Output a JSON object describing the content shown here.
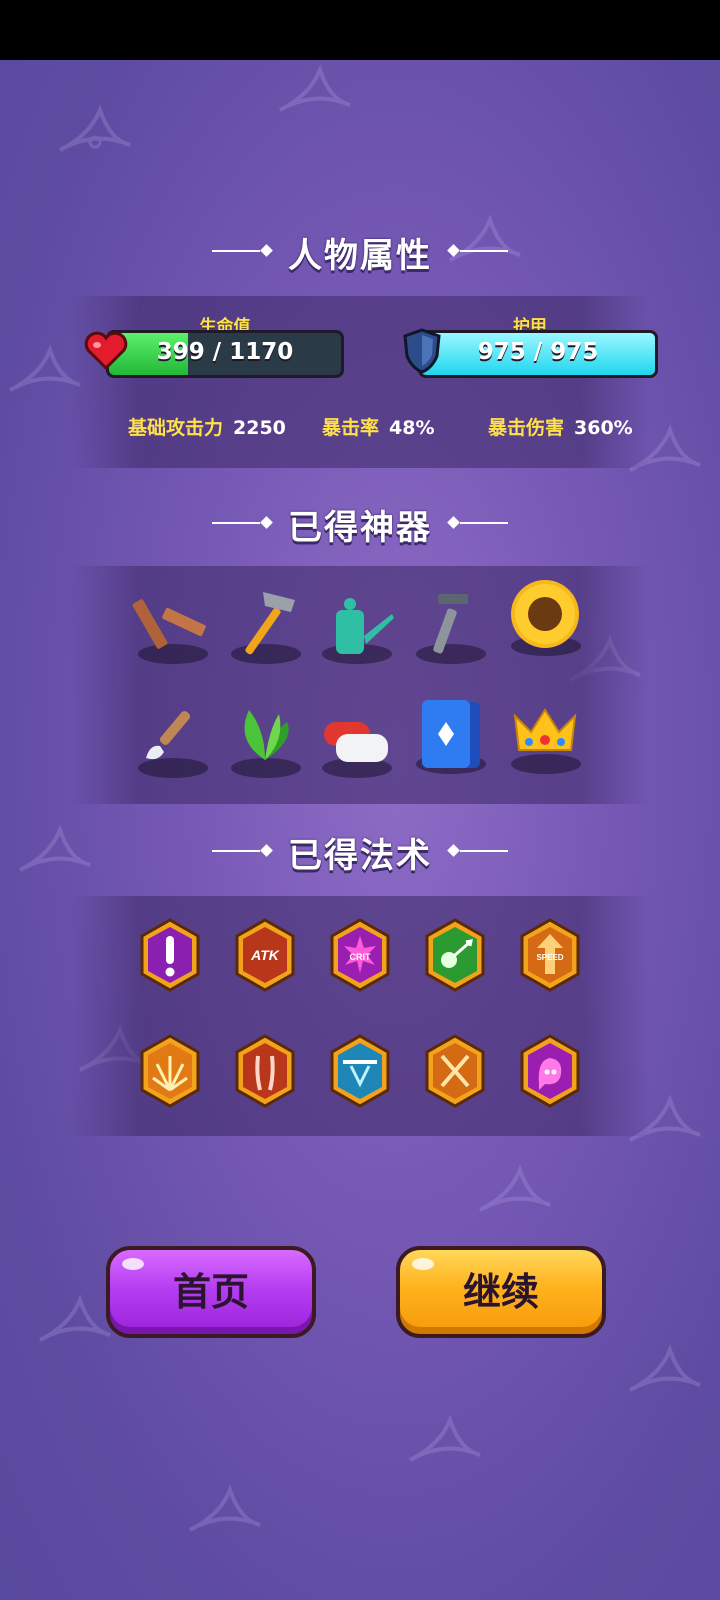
{
  "stats_section": {
    "title": "人物属性",
    "hp": {
      "label": "生命值",
      "value": "399 / 1170",
      "fill_fraction": 0.34
    },
    "armor": {
      "label": "护甲",
      "value": "975 / 975",
      "fill_fraction": 1.0
    },
    "base_attack": {
      "label": "基础攻击力",
      "value": "2250"
    },
    "crit_rate": {
      "label": "暴击率",
      "value": "48%"
    },
    "crit_damage": {
      "label": "暴击伤害",
      "value": "360%"
    }
  },
  "artifacts_section": {
    "title": "已得神器",
    "items": [
      "wooden-planks-icon",
      "hammer-icon",
      "watering-can-icon",
      "razor-icon",
      "sunflower-icon",
      "paintbrush-icon",
      "leaf-plant-icon",
      "earbuds-case-icon",
      "playing-card-icon",
      "crown-icon"
    ]
  },
  "spells_section": {
    "title": "已得法术",
    "items": [
      "exclamation-spell-icon",
      "atk-spell-icon",
      "crit-spell-icon",
      "skull-spell-icon",
      "speed-spell-icon",
      "burst-spell-icon",
      "claws-spell-icon",
      "bow-spell-icon",
      "crossed-swords-spell-icon",
      "ghost-spell-icon"
    ]
  },
  "buttons": {
    "home": "首页",
    "continue": "继续"
  },
  "colors": {
    "hp_fill": "#2ecc4a",
    "armor_fill": "#2ee6f5",
    "label_yellow": "#ffe14a",
    "home_button": "#b63ef2",
    "continue_button": "#ffb21d"
  },
  "badge_texts": {
    "atk": "ATK",
    "crit": "CRIT",
    "speed": "SPEED"
  }
}
